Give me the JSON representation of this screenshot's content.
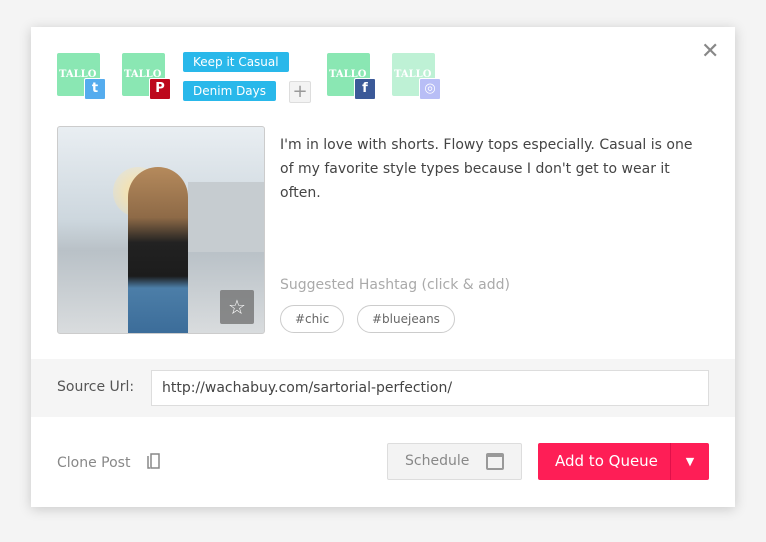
{
  "accounts": [
    {
      "name": "TALLO",
      "network": "twitter",
      "icon": "twitter-icon",
      "color": "#55acee",
      "glyph": "t"
    },
    {
      "name": "TALLO",
      "network": "pinterest",
      "icon": "pinterest-icon",
      "color": "#bd081c",
      "glyph": "P"
    },
    {
      "name": "TALLO",
      "network": "facebook",
      "icon": "facebook-icon",
      "color": "#3b5998",
      "glyph": "f"
    },
    {
      "name": "TALLO",
      "network": "instagram",
      "icon": "instagram-icon",
      "color": "#a0a8f0",
      "glyph": "◎"
    }
  ],
  "tags": [
    "Keep it Casual",
    "Denim Days"
  ],
  "add_tag": "+",
  "close": "✕",
  "post_text": "I'm in love with shorts. Flowy tops especially. Casual is one of my favorite style types because I don't get to wear it often.",
  "suggested_label": "Suggested Hashtag (click & add)",
  "hashtags": [
    "#chic",
    "#bluejeans"
  ],
  "source_label": "Source Url:",
  "source_url": "http://wachabuy.com/sartorial-perfection/",
  "clone_label": "Clone Post",
  "schedule_label": "Schedule",
  "queue_label": "Add to Queue",
  "accent": "#fe1e56"
}
